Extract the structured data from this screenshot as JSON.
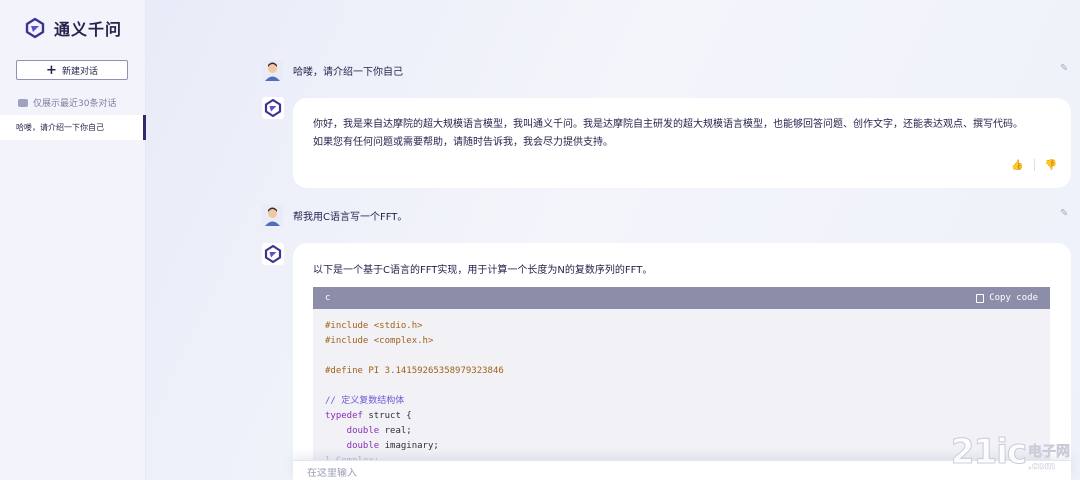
{
  "app": {
    "name": "通义千问"
  },
  "sidebar": {
    "new_chat_label": "新建对话",
    "history_note": "仅展示最近30条对话",
    "history_items": [
      {
        "label": "哈喽，请介绍一下你自己"
      }
    ]
  },
  "conversation": {
    "user_messages": [
      {
        "text": "哈喽，请介绍一下你自己"
      },
      {
        "text": "帮我用C语言写一个FFT。"
      }
    ],
    "replies": [
      {
        "text_line1": "你好，我是来自达摩院的超大规模语言模型，我叫通义千问。我是达摩院自主研发的超大规模语言模型，也能够回答问题、创作文字，还能表达观点、撰写代码。",
        "text_line2": "如果您有任何问题或需要帮助，请随时告诉我，我会尽力提供支持。"
      },
      {
        "intro": "以下是一个基于C语言的FFT实现，用于计算一个长度为N的复数序列的FFT。",
        "code_language": "c",
        "copy_label": "Copy code",
        "code_lines": {
          "l1": "#include <stdio.h>",
          "l2": "#include <complex.h>",
          "l4": "#define PI 3.14159265358979323846",
          "l6": "// 定义复数结构体",
          "l7a": "typedef",
          "l7b": " struct {",
          "l8a": "    double",
          "l8b": " real;",
          "l9a": "    double",
          "l9b": " imaginary;",
          "l10": "} Complex;"
        }
      }
    ]
  },
  "input": {
    "placeholder": "在这里输入"
  },
  "watermark": {
    "big": "21ic",
    "cn": "电子网",
    "en": ".com"
  },
  "colors": {
    "accent": "#2f2a6e",
    "code_header": "#8b8da9",
    "background": "#eef0f8"
  }
}
